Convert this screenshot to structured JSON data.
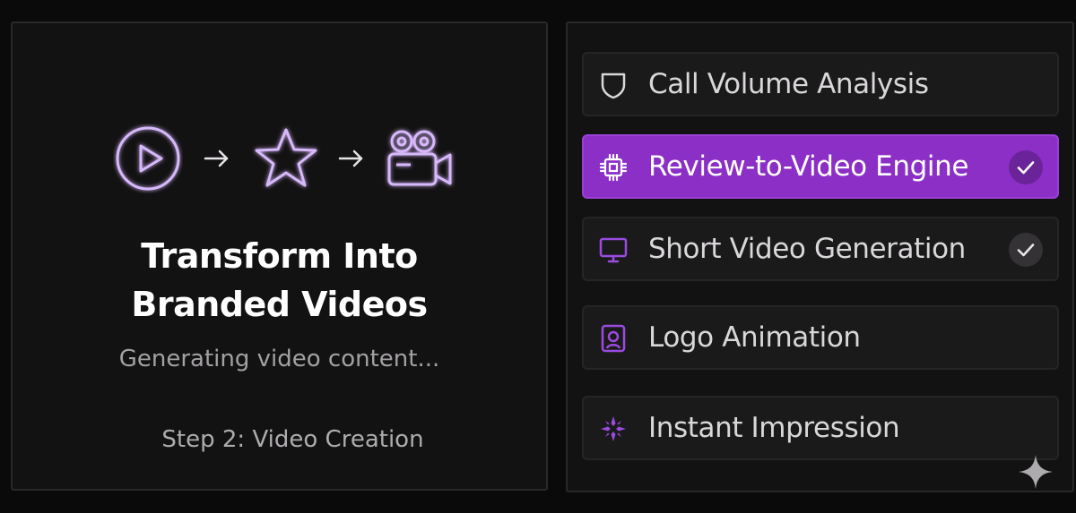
{
  "left": {
    "headline_line1": "Transform Into",
    "headline_line2": "Branded Videos",
    "status": "Generating video content...",
    "step": "Step 2: Video Creation",
    "flow_icons": [
      "play-circle-icon",
      "arrow-right-icon",
      "star-icon",
      "arrow-right-icon",
      "video-camera-icon"
    ]
  },
  "features": [
    {
      "label": "Call Volume Analysis",
      "icon": "shield-icon",
      "active": false,
      "checked": false
    },
    {
      "label": "Review-to-Video Engine",
      "icon": "cpu-chip-icon",
      "active": true,
      "checked": true
    },
    {
      "label": "Short Video Generation",
      "icon": "monitor-icon",
      "active": false,
      "checked": true
    },
    {
      "label": "Logo Animation",
      "icon": "portrait-badge-icon",
      "active": false,
      "checked": false
    },
    {
      "label": "Instant Impression",
      "icon": "sparkles-icon",
      "active": false,
      "checked": false
    }
  ],
  "colors": {
    "background": "#0b0a0b",
    "panel": "#131213",
    "accent_purple": "#8c2fc6",
    "glow_purple": "#c9a4f5",
    "card": "#1b1a1b"
  }
}
